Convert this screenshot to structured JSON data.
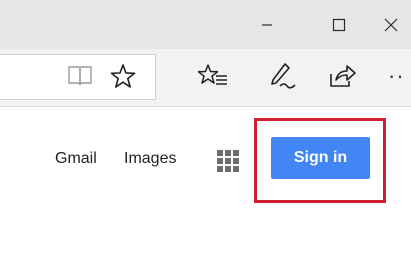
{
  "browser": {
    "window_controls": {
      "minimize_icon": "minimize-icon",
      "maximize_icon": "maximize-icon",
      "close_icon": "close-icon"
    },
    "toolbar": {
      "icons": [
        "reading-view-icon",
        "favorite-star-icon",
        "hub-icon",
        "web-note-icon",
        "share-icon",
        "more-icon"
      ],
      "more_label": "··"
    }
  },
  "page": {
    "links": {
      "gmail": "Gmail",
      "images": "Images"
    },
    "apps_icon": "apps-grid-icon",
    "signin_label": "Sign in",
    "colors": {
      "signin_bg": "#4285f4",
      "highlight_border": "#d0202d"
    }
  }
}
